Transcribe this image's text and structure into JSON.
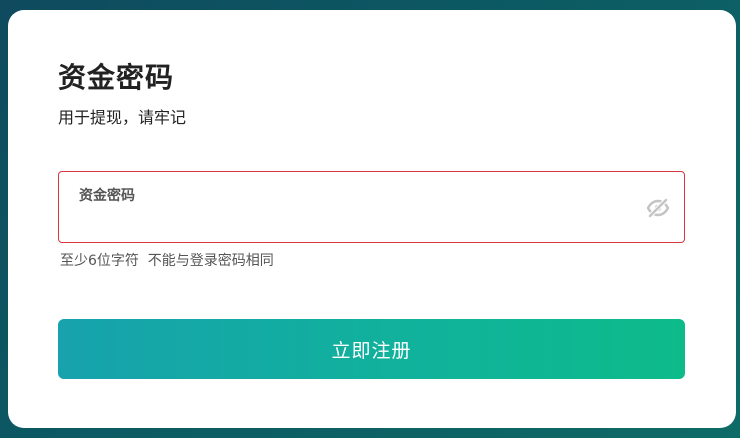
{
  "page": {
    "title": "资金密码",
    "subtitle": "用于提现，请牢记"
  },
  "password_field": {
    "label": "资金密码",
    "value": "",
    "toggle_icon": "eye-slash-icon",
    "border_color": "#d9363e"
  },
  "hint": "至少6位字符  不能与登录密码相同",
  "submit_label": "立即注册",
  "colors": {
    "accent_start": "#17a2ad",
    "accent_end": "#0dbb8a",
    "error": "#d9363e"
  }
}
